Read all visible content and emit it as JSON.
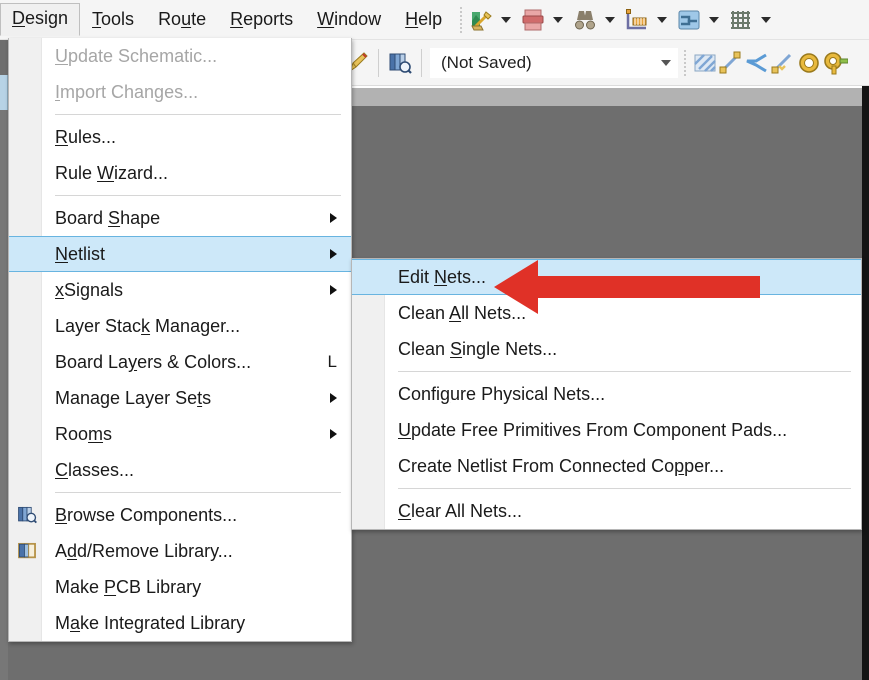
{
  "app": {
    "accent_selection": "#cde8f9",
    "selection_border": "#68b4e0",
    "annotation_color": "#e03127",
    "canvas_dark": "#6e6e6e",
    "canvas_light": "#b2b2b2"
  },
  "menubar": {
    "items": [
      {
        "label": "Design",
        "mnemonic": "D",
        "open": true
      },
      {
        "label": "Tools",
        "mnemonic": "T",
        "open": false
      },
      {
        "label": "Route",
        "mnemonic": "u",
        "open": false
      },
      {
        "label": "Reports",
        "mnemonic": "R",
        "open": false
      },
      {
        "label": "Window",
        "mnemonic": "W",
        "open": false
      },
      {
        "label": "Help",
        "mnemonic": "H",
        "open": false
      }
    ],
    "toolbar_icons": [
      {
        "name": "draw-schematic-icon",
        "has_caret": true
      },
      {
        "name": "print-preview-icon",
        "has_caret": true
      },
      {
        "name": "find-similar-icon",
        "has_caret": true
      },
      {
        "name": "measure-tool-icon",
        "has_caret": true
      },
      {
        "name": "layer-stack-icon",
        "has_caret": true
      },
      {
        "name": "grid-icon",
        "has_caret": true
      }
    ]
  },
  "toolbar2": {
    "pencil_icon": "edit-pencil-icon",
    "browse-icon": "browse-components-icon",
    "combo": {
      "name": "view-configuration-combo",
      "value": "(Not Saved)",
      "placeholder": "(Not Saved)"
    },
    "icons": [
      {
        "name": "polygon-pour-icon"
      },
      {
        "name": "interactive-routing-icon"
      },
      {
        "name": "differential-pair-routing-icon"
      },
      {
        "name": "interactive-length-tuning-icon"
      },
      {
        "name": "place-via-icon"
      },
      {
        "name": "place-pad-icon"
      }
    ]
  },
  "design_menu": {
    "name": "design-menu",
    "items": [
      {
        "id": "update-schematic",
        "label": "Update Schematic...",
        "mnemonic": "U",
        "disabled": true,
        "submenu": false,
        "shortcut": "",
        "icon": ""
      },
      {
        "id": "import-changes",
        "label": "Import Changes...",
        "mnemonic": "I",
        "disabled": true,
        "submenu": false,
        "shortcut": "",
        "icon": ""
      },
      {
        "id": "separator-1",
        "type": "separator"
      },
      {
        "id": "rules",
        "label": "Rules...",
        "mnemonic": "R",
        "disabled": false,
        "submenu": false,
        "shortcut": "",
        "icon": ""
      },
      {
        "id": "rule-wizard",
        "label": "Rule Wizard...",
        "mnemonic": "W",
        "disabled": false,
        "submenu": false,
        "shortcut": "",
        "icon": ""
      },
      {
        "id": "separator-2",
        "type": "separator"
      },
      {
        "id": "board-shape",
        "label": "Board Shape",
        "mnemonic": "S",
        "disabled": false,
        "submenu": true,
        "shortcut": "",
        "icon": ""
      },
      {
        "id": "netlist",
        "label": "Netlist",
        "mnemonic": "N",
        "disabled": false,
        "submenu": true,
        "shortcut": "",
        "icon": "",
        "selected": true
      },
      {
        "id": "xsignals",
        "label": "xSignals",
        "mnemonic": "x",
        "disabled": false,
        "submenu": true,
        "shortcut": "",
        "icon": ""
      },
      {
        "id": "layer-stack-manager",
        "label": "Layer Stack Manager...",
        "mnemonic": "k",
        "disabled": false,
        "submenu": false,
        "shortcut": "",
        "icon": ""
      },
      {
        "id": "board-layers-colors",
        "label": "Board Layers & Colors...",
        "mnemonic": "y",
        "disabled": false,
        "submenu": false,
        "shortcut": "L",
        "icon": ""
      },
      {
        "id": "manage-layer-sets",
        "label": "Manage Layer Sets",
        "mnemonic": "t",
        "disabled": false,
        "submenu": true,
        "shortcut": "",
        "icon": ""
      },
      {
        "id": "rooms",
        "label": "Rooms",
        "mnemonic": "m",
        "disabled": false,
        "submenu": true,
        "shortcut": "",
        "icon": ""
      },
      {
        "id": "classes",
        "label": "Classes...",
        "mnemonic": "C",
        "disabled": false,
        "submenu": false,
        "shortcut": "",
        "icon": ""
      },
      {
        "id": "separator-3",
        "type": "separator"
      },
      {
        "id": "browse-components",
        "label": "Browse Components...",
        "mnemonic": "B",
        "disabled": false,
        "submenu": false,
        "shortcut": "",
        "icon": "browse-components-icon"
      },
      {
        "id": "add-remove-library",
        "label": "Add/Remove Library...",
        "mnemonic": "d",
        "disabled": false,
        "submenu": false,
        "shortcut": "",
        "icon": "library-icon"
      },
      {
        "id": "make-pcb-library",
        "label": "Make PCB Library",
        "mnemonic": "P",
        "disabled": false,
        "submenu": false,
        "shortcut": "",
        "icon": ""
      },
      {
        "id": "make-integrated-library",
        "label": "Make Integrated Library",
        "mnemonic": "a",
        "disabled": false,
        "submenu": false,
        "shortcut": "",
        "icon": ""
      }
    ]
  },
  "netlist_submenu": {
    "name": "netlist-submenu",
    "items": [
      {
        "id": "edit-nets",
        "label": "Edit Nets...",
        "mnemonic": "N",
        "selected": true,
        "submenu": false
      },
      {
        "id": "clean-all-nets",
        "label": "Clean All Nets...",
        "mnemonic": "A",
        "selected": false,
        "submenu": false
      },
      {
        "id": "clean-single-nets",
        "label": "Clean Single Nets...",
        "mnemonic": "S",
        "selected": false,
        "submenu": false
      },
      {
        "id": "separator-1",
        "type": "separator"
      },
      {
        "id": "configure-physical-nets",
        "label": "Configure Physical Nets...",
        "mnemonic": "g",
        "selected": false,
        "submenu": false
      },
      {
        "id": "update-free-primitives",
        "label": "Update Free Primitives From Component Pads...",
        "mnemonic": "U",
        "selected": false,
        "submenu": false
      },
      {
        "id": "create-netlist-copper",
        "label": "Create Netlist From Connected Copper...",
        "mnemonic": "p",
        "selected": false,
        "submenu": false
      },
      {
        "id": "separator-2",
        "type": "separator"
      },
      {
        "id": "clear-all-nets",
        "label": "Clear All Nets...",
        "mnemonic": "C",
        "selected": false,
        "submenu": false
      }
    ]
  },
  "annotation": {
    "name": "red-callout-arrow",
    "points_to": "edit-nets",
    "direction": "left"
  }
}
